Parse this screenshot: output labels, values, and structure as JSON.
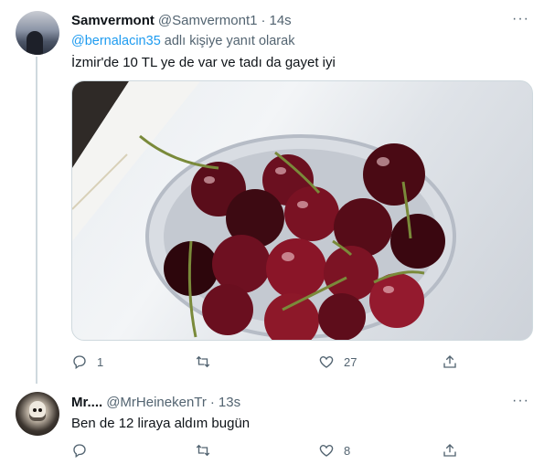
{
  "tweet1": {
    "name": "Samvermont",
    "handle": "@Samvermont1",
    "separator": "·",
    "time": "14s",
    "reply_mention": "@bernalacin35",
    "reply_suffix": " adlı kişiye yanıt olarak",
    "text": "İzmir'de 10 TL ye de var ve tadı da gayet iyi",
    "media_alt": "cherries-in-glass-bowl",
    "actions": {
      "reply_count": "1",
      "retweet_count": "",
      "like_count": "27"
    }
  },
  "tweet2": {
    "name": "Mr....",
    "handle": "@MrHeinekenTr",
    "separator": "·",
    "time": "13s",
    "text": "Ben de 12 liraya aldım bugün",
    "actions": {
      "reply_count": "",
      "retweet_count": "",
      "like_count": "8"
    }
  },
  "more_label": "···",
  "colors": {
    "link": "#1d9bf0",
    "muted": "#536471",
    "text": "#0f1419",
    "line": "#cfd9de"
  }
}
